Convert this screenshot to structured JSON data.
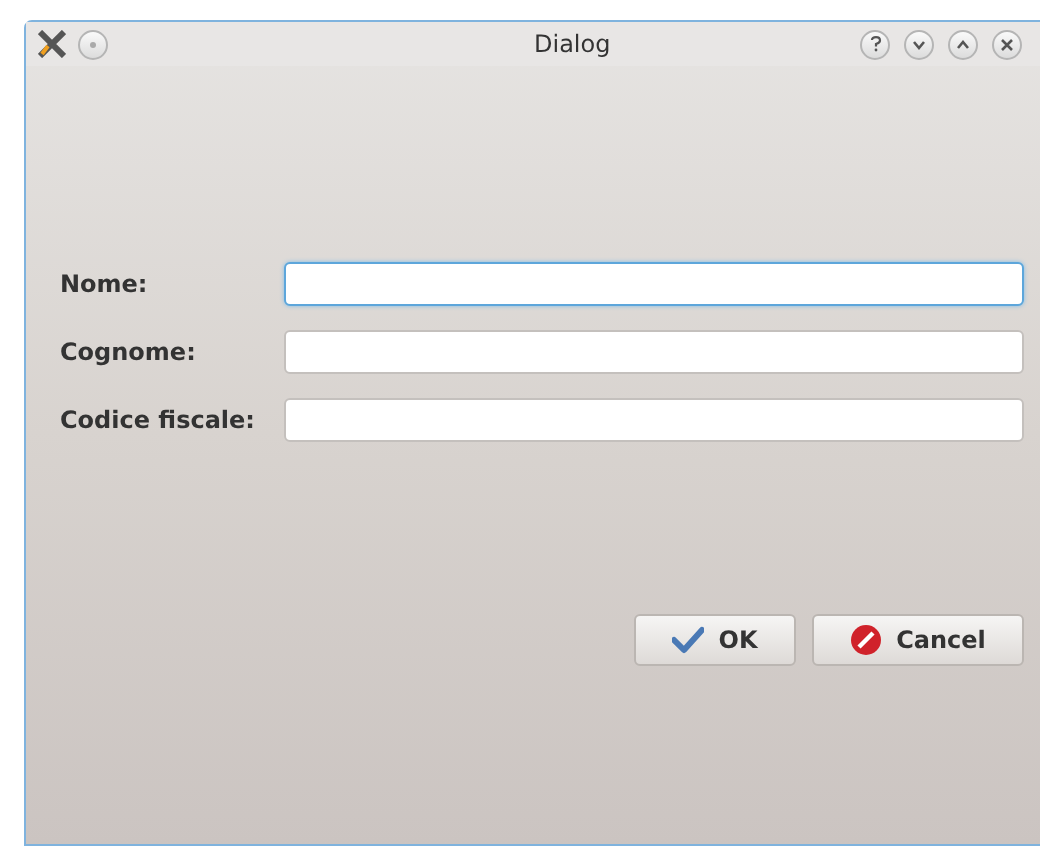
{
  "window": {
    "title": "Dialog"
  },
  "fields": [
    {
      "label": "Nome:",
      "focused": true
    },
    {
      "label": "Cognome:",
      "focused": false
    },
    {
      "label": "Codice fiscale:",
      "focused": false
    }
  ],
  "buttons": [
    {
      "label": "OK",
      "kind": "accept"
    },
    {
      "label": "Cancel",
      "kind": "reject"
    }
  ]
}
